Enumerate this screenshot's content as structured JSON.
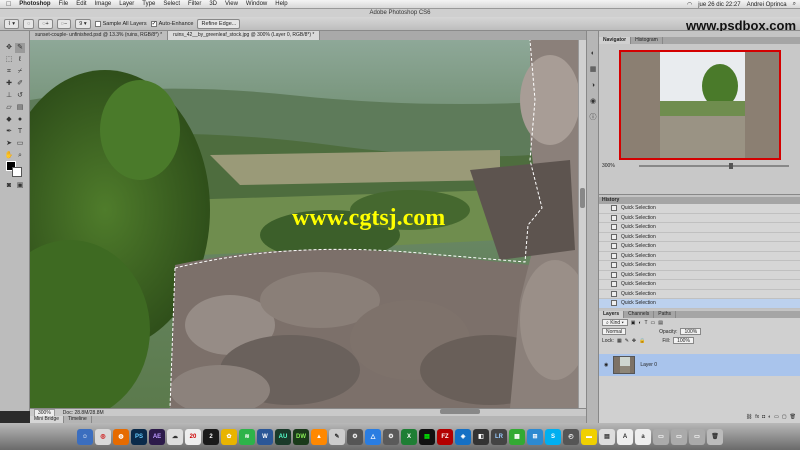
{
  "menubar": {
    "app_name": "Photoshop",
    "items": [
      "File",
      "Edit",
      "Image",
      "Layer",
      "Type",
      "Select",
      "Filter",
      "3D",
      "View",
      "Window",
      "Help"
    ],
    "clock": "jue 26 dic  22:27",
    "user": "Andrei Oprinca"
  },
  "window_title": "Adobe Photoshop CS6",
  "options": {
    "brush_size": "9",
    "sample_all_layers": "Sample All Layers",
    "auto_enhance": "Auto-Enhance",
    "refine_edge": "Refine Edge..."
  },
  "watermark_top": "www.psdbox.com",
  "doc_tabs": [
    "sunset-couple- unfinished.psd @ 13.3% (ruins, RGB/8*) *",
    "ruins_42__by_greenleaf_stock.jpg @ 300% (Layer 0, RGB/8*) *"
  ],
  "canvas_watermark": "www.cgtsj.com",
  "status": {
    "zoom": "300%",
    "doc": "Doc: 28.8M/28.8M"
  },
  "bottom_tabs": [
    "Mini Bridge",
    "Timeline"
  ],
  "navigator": {
    "tabs": [
      "Navigator",
      "Histogram"
    ],
    "zoom": "300%"
  },
  "history": {
    "title": "History",
    "items": [
      "Quick Selection",
      "Quick Selection",
      "Quick Selection",
      "Quick Selection",
      "Quick Selection",
      "Quick Selection",
      "Quick Selection",
      "Quick Selection",
      "Quick Selection",
      "Quick Selection",
      "Quick Selection"
    ]
  },
  "layers": {
    "tabs": [
      "Layers",
      "Channels",
      "Paths"
    ],
    "kind": "Kind",
    "blend_mode": "Normal",
    "opacity_label": "Opacity:",
    "opacity": "100%",
    "lock_label": "Lock:",
    "fill_label": "Fill:",
    "fill": "100%",
    "layer_name": "Layer 0"
  },
  "dock": [
    "AI",
    "PS",
    "AE",
    "ID",
    "20",
    "2",
    "S",
    "W",
    "AU",
    "DW",
    "VLC",
    "LR",
    "FZ",
    "S",
    "A"
  ]
}
